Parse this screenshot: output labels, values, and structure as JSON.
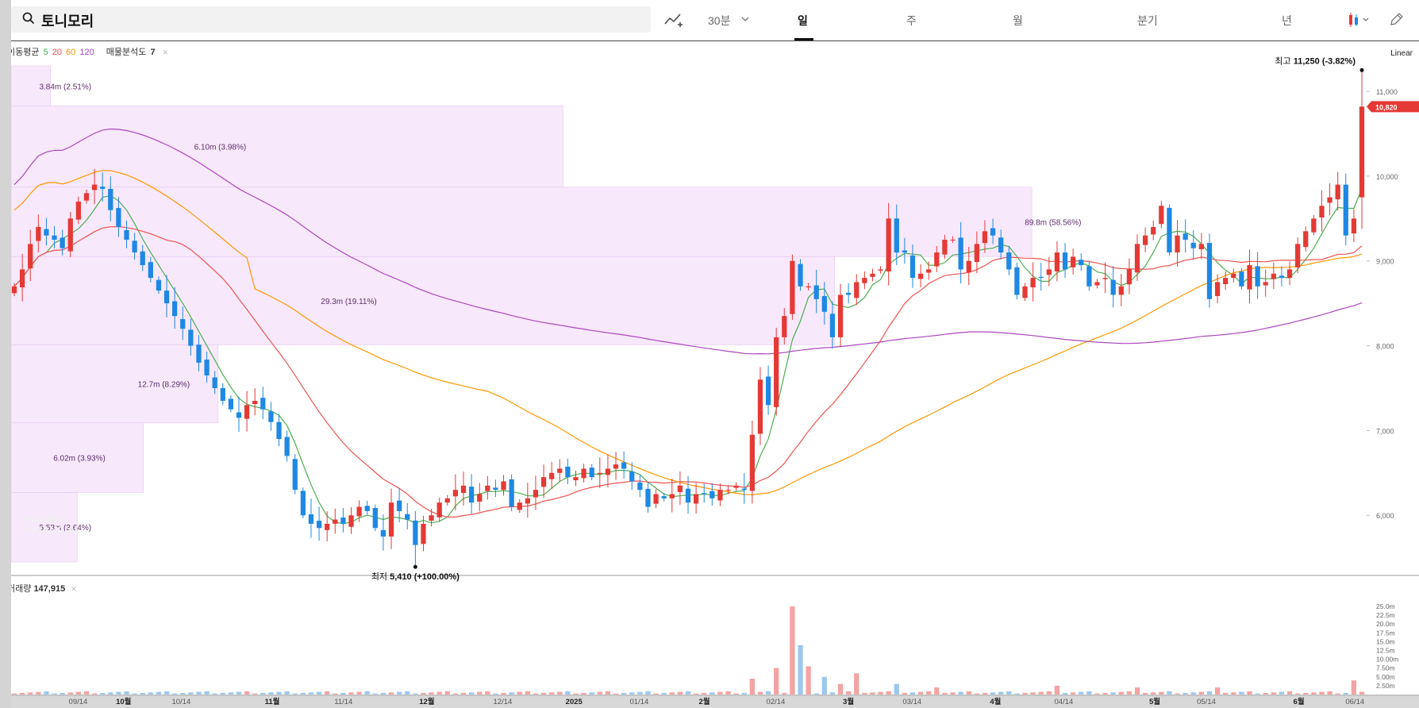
{
  "header": {
    "stock_name": "토니모리",
    "interval_label": "30분",
    "periods": [
      "일",
      "주",
      "월",
      "분기",
      "년"
    ],
    "active_period": "일"
  },
  "legend": {
    "ma_label": "이동평균",
    "ma_periods": [
      "5",
      "20",
      "60",
      "120"
    ],
    "ma_colors": [
      "#4caf50",
      "#ef5350",
      "#ff9800",
      "#ab47bc"
    ],
    "volume_profile_label": "매물분석도",
    "volume_profile_value": "7",
    "volume_label": "거래량",
    "volume_value": "147,915"
  },
  "scale_mode": "Linear",
  "chart_data": [
    {
      "type": "candlestick",
      "x_axis_labels": [
        "09/14",
        "10월",
        "10/14",
        "11월",
        "11/14",
        "12월",
        "12/14",
        "2025",
        "01/14",
        "2월",
        "02/14",
        "3월",
        "03/14",
        "4월",
        "04/14",
        "5월",
        "05/14",
        "6월",
        "06/14"
      ],
      "y_ticks": [
        "6,000",
        "7,000",
        "8,000",
        "9,000",
        "10,000",
        "11,000"
      ],
      "y_range": [
        5300,
        11600
      ],
      "current_price": "10,820",
      "high_annotation": {
        "label": "최고",
        "value": "11,250",
        "change": "(-3.82%)"
      },
      "low_annotation": {
        "label": "최저",
        "value": "5,410",
        "change": "(+100.00%)"
      },
      "closes": [
        8700,
        8900,
        9200,
        9400,
        9300,
        9250,
        9150,
        9500,
        9700,
        9800,
        9900,
        9850,
        9600,
        9400,
        9250,
        9100,
        8950,
        8800,
        8650,
        8500,
        8350,
        8200,
        8000,
        7800,
        7650,
        7500,
        7350,
        7250,
        7150,
        7300,
        7350,
        7250,
        7100,
        6900,
        6700,
        6300,
        6000,
        5900,
        5850,
        5900,
        5950,
        5900,
        6000,
        6100,
        6050,
        5850,
        5750,
        6150,
        6050,
        5950,
        5650,
        5900,
        6000,
        6150,
        6200,
        6300,
        6350,
        6150,
        6250,
        6350,
        6300,
        6400,
        6100,
        6150,
        6200,
        6300,
        6450,
        6500,
        6550,
        6450,
        6450,
        6550,
        6450,
        6500,
        6550,
        6600,
        6550,
        6400,
        6300,
        6100,
        6250,
        6200,
        6250,
        6350,
        6150,
        6250,
        6250,
        6200,
        6300,
        6300,
        6350,
        6300,
        6950,
        7600,
        7300,
        8100,
        8350,
        9000,
        8700,
        8700,
        8550,
        8400,
        8100,
        8600,
        8600,
        8750,
        8800,
        8850,
        8900,
        9500,
        9100,
        9100,
        8800,
        8850,
        8900,
        9100,
        9250,
        9250,
        8900,
        9000,
        9200,
        9350,
        9300,
        9100,
        8900,
        8600,
        8700,
        8800,
        8800,
        8900,
        9100,
        8900,
        9050,
        8950,
        8700,
        8750,
        8800,
        8600,
        8700,
        8900,
        9200,
        9300,
        9400,
        9650,
        9100,
        9300,
        9250,
        9150,
        9200,
        8550,
        8750,
        8800,
        8850,
        8700,
        8950,
        8700,
        8750,
        8850,
        8800,
        8900,
        9200,
        9350,
        9500,
        9650,
        9750,
        9900,
        9300,
        9500,
        10820
      ],
      "volume_y_ticks": [
        "2.50m",
        "5.00m",
        "7.50m",
        "10.00m",
        "12.5m",
        "15.0m",
        "17.5m",
        "20.0m",
        "22.5m",
        "25.0m"
      ],
      "volume_peak": "25.0m"
    },
    {
      "type": "volume_profile",
      "label_series": "매물분석도",
      "zones": [
        {
          "label": "3.84m (2.51%)"
        },
        {
          "label": "6.10m (3.98%)"
        },
        {
          "label": "29.3m (19.11%)"
        },
        {
          "label": "89.8m (58.56%)"
        },
        {
          "label": "12.7m (8.29%)"
        },
        {
          "label": "6.02m (3.93%)"
        },
        {
          "label": "5.58m (3.64%)"
        }
      ]
    }
  ]
}
